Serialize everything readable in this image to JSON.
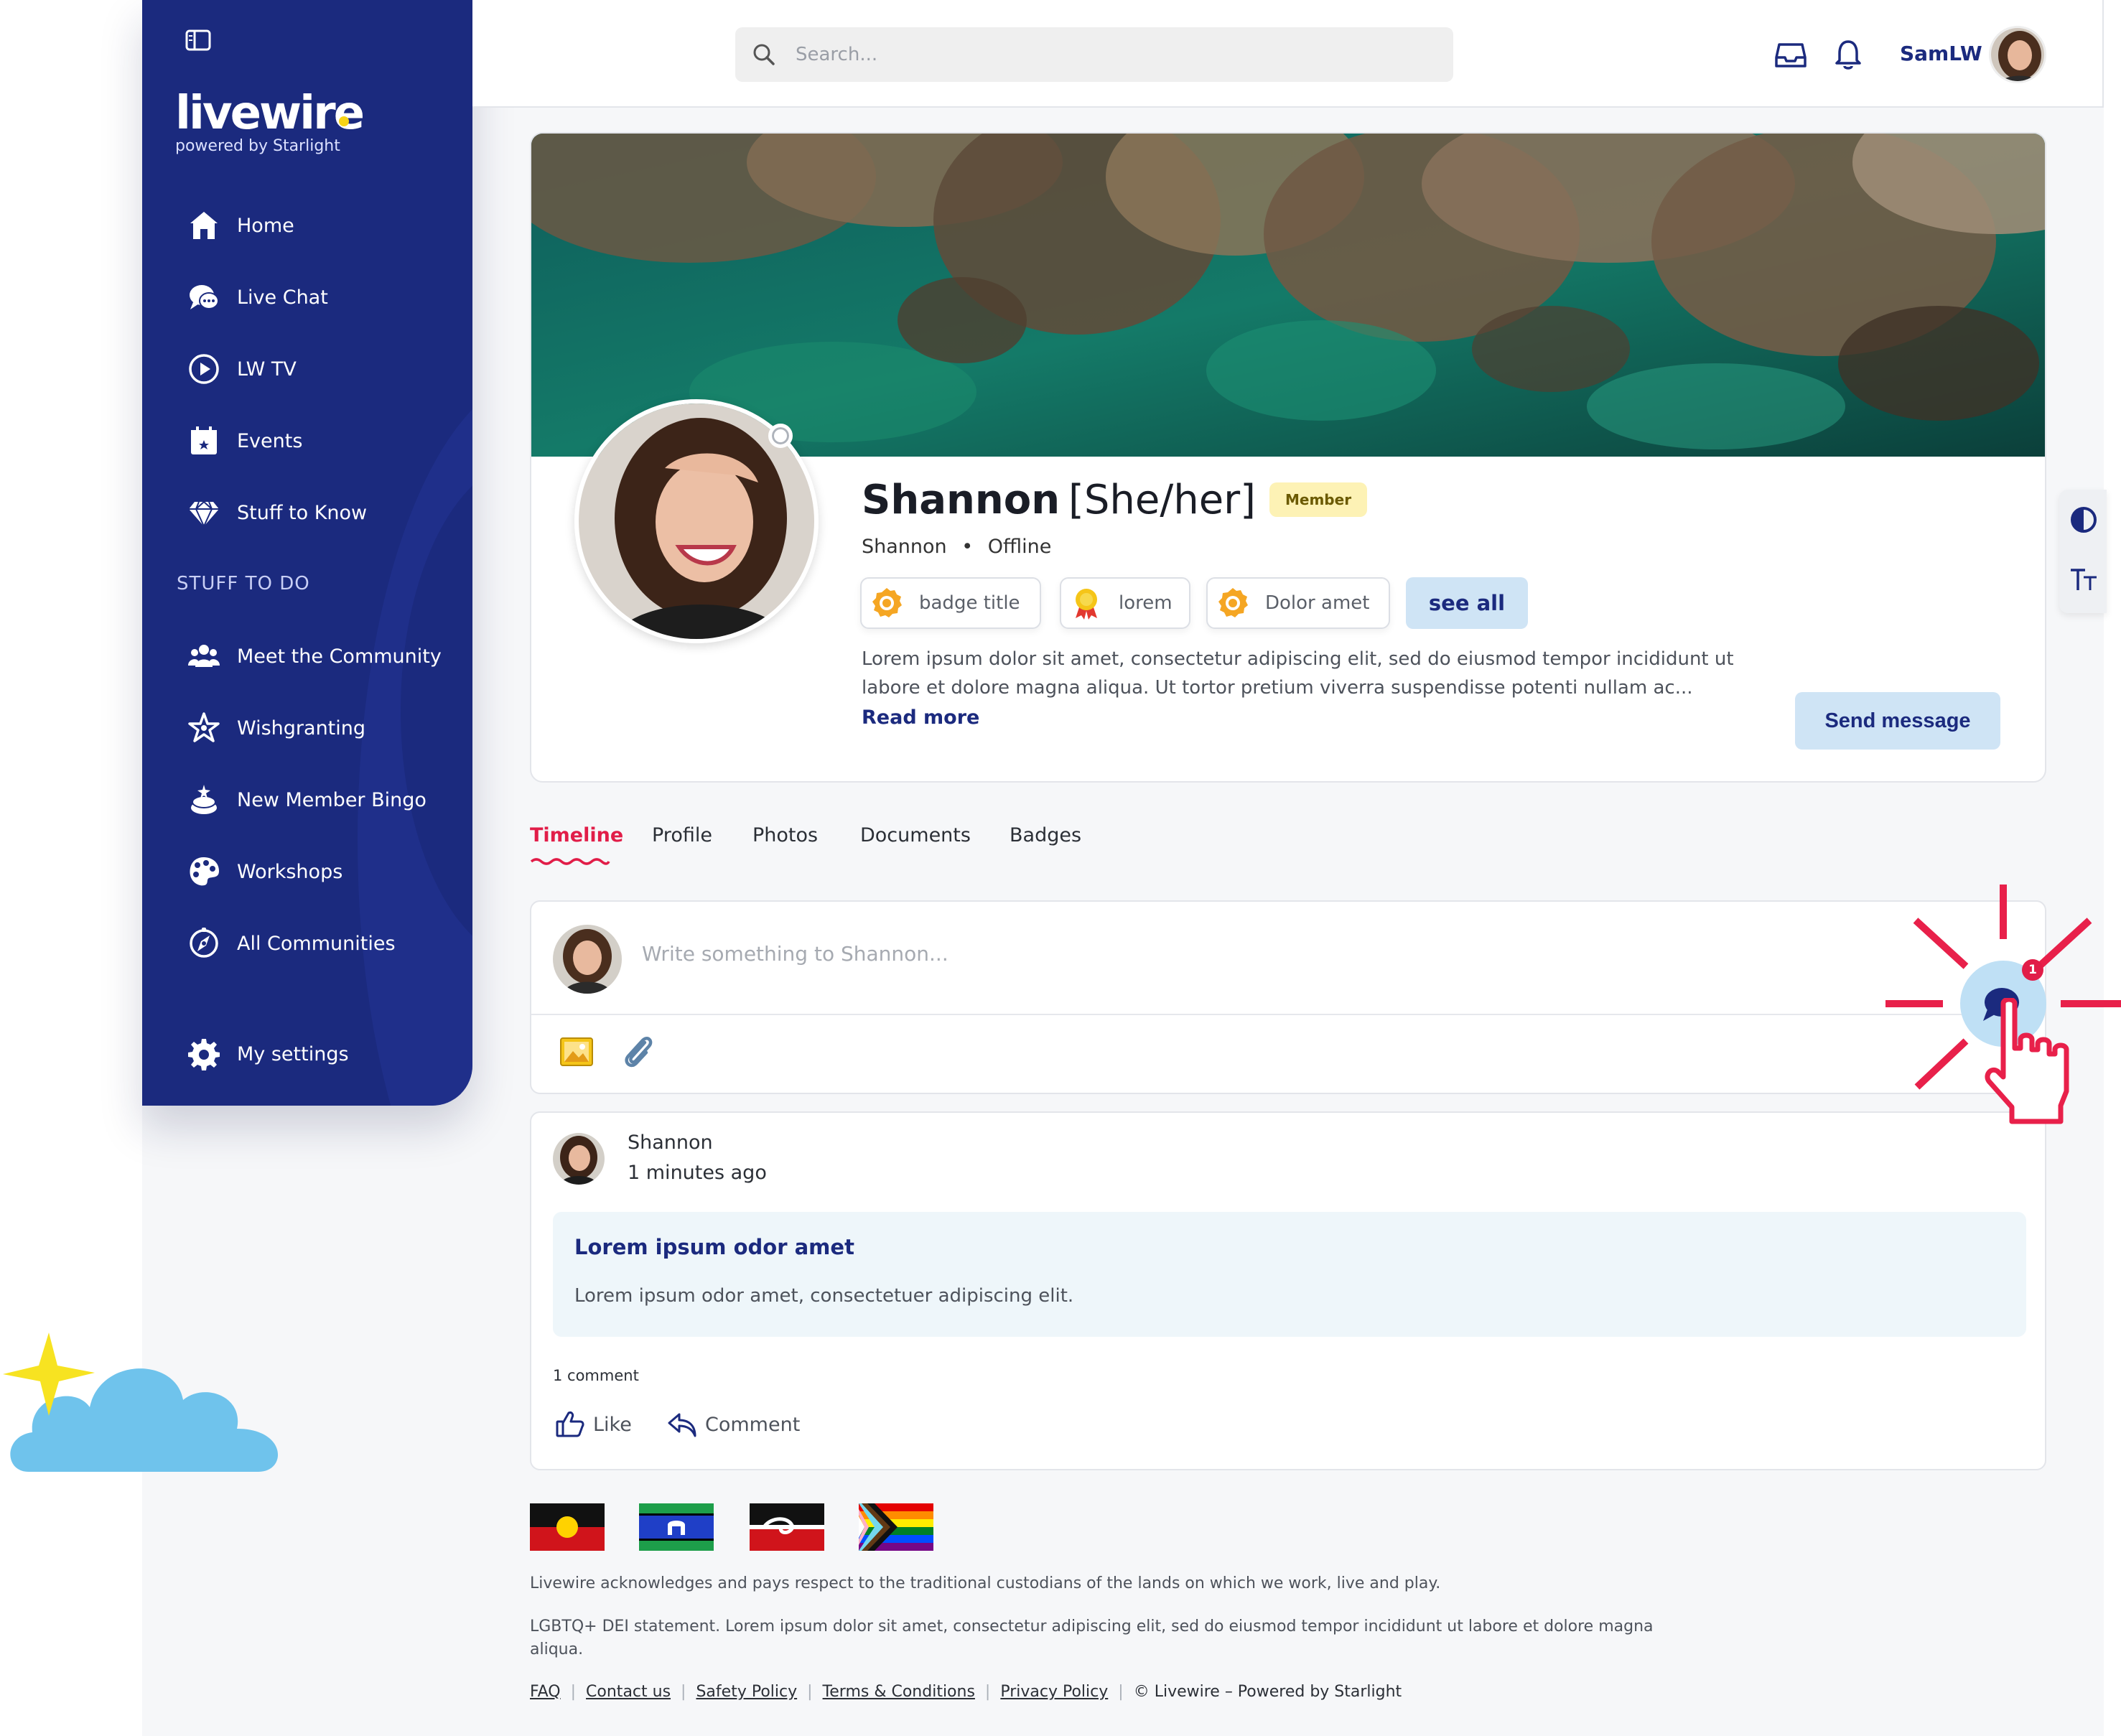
{
  "app": {
    "brand": "livewire",
    "brand_sub": "powered by Starlight"
  },
  "sidebar": {
    "items": [
      {
        "label": "Home",
        "icon": "home-icon"
      },
      {
        "label": "Live Chat",
        "icon": "chat-icon"
      },
      {
        "label": "LW TV",
        "icon": "play-icon"
      },
      {
        "label": "Events",
        "icon": "calendar-icon"
      },
      {
        "label": "Stuff to Know",
        "icon": "diamond-icon"
      }
    ],
    "section_heading": "STUFF TO DO",
    "todo_items": [
      {
        "label": "Meet the Community",
        "icon": "community-icon"
      },
      {
        "label": "Wishgranting",
        "icon": "wish-star-icon"
      },
      {
        "label": "New Member Bingo",
        "icon": "bingo-icon"
      },
      {
        "label": "Workshops",
        "icon": "palette-icon"
      },
      {
        "label": "All Communities",
        "icon": "compass-icon"
      }
    ],
    "settings_label": "My settings"
  },
  "topbar": {
    "search_placeholder": "Search...",
    "username": "SamLW"
  },
  "profile": {
    "name": "Shannon",
    "pronouns": "[She/her]",
    "role": "Member",
    "display_name": "Shannon",
    "status": "Offline",
    "badges": [
      {
        "label": "badge title",
        "icon": "orange-badge-icon"
      },
      {
        "label": "lorem",
        "icon": "ribbon-award-icon"
      },
      {
        "label": "Dolor amet",
        "icon": "orange-badge-icon"
      }
    ],
    "see_all_label": "see all",
    "bio_line1": "Lorem ipsum dolor sit amet, consectetur adipiscing elit, sed do eiusmod tempor incididunt ut",
    "bio_line2": "labore et dolore magna aliqua. Ut tortor pretium viverra suspendisse potenti nullam ac...",
    "read_more": "Read more",
    "send_message": "Send message"
  },
  "tabs": [
    {
      "label": "Timeline",
      "active": true
    },
    {
      "label": "Profile"
    },
    {
      "label": "Photos"
    },
    {
      "label": "Documents"
    },
    {
      "label": "Badges"
    }
  ],
  "composer": {
    "placeholder": "Write something to Shannon..."
  },
  "post": {
    "author": "Shannon",
    "time": "1 minutes ago",
    "title": "Lorem ipsum odor amet",
    "body": "Lorem ipsum odor amet, consectetuer adipiscing elit.",
    "comment_count": "1 comment",
    "like_label": "Like",
    "comment_label": "Comment"
  },
  "chat_fab": {
    "unread": "1"
  },
  "footer": {
    "acknowledgement": "Livewire acknowledges and pays respect to the traditional custodians of the lands on which we work, live and play.",
    "statement_line1": "LGBTQ+ DEI statement. Lorem ipsum dolor sit amet, consectetur adipiscing elit, sed do eiusmod tempor incididunt ut labore et dolore magna",
    "statement_line2": "aliqua.",
    "links": [
      "FAQ",
      "Contact us",
      "Safety Policy",
      "Terms & Conditions",
      "Privacy Policy"
    ],
    "copyright": "© Livewire – Powered by Starlight",
    "flags": [
      "aboriginal-flag",
      "torres-strait-islander-flag",
      "tino-rangatiratanga-flag",
      "progress-pride-flag"
    ]
  },
  "colors": {
    "sidebar": "#1b2a7e",
    "accent": "#e11d48",
    "button_bg": "#cfe4f5",
    "role_badge": "#fdf2b5"
  }
}
